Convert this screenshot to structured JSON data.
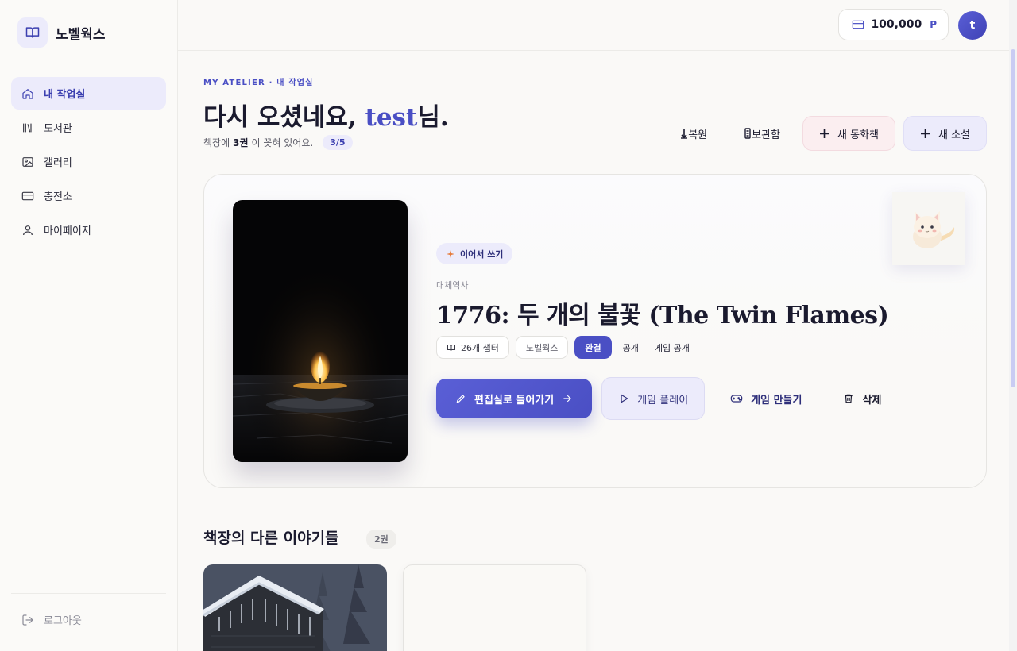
{
  "brand": {
    "name": "노벨웍스",
    "icon": "book-open-icon"
  },
  "sidebar": {
    "items": [
      {
        "label": "내 작업실",
        "icon": "home-icon",
        "active": true
      },
      {
        "label": "도서관",
        "icon": "library-icon"
      },
      {
        "label": "갤러리",
        "icon": "image-icon"
      },
      {
        "label": "충전소",
        "icon": "credit-card-icon"
      },
      {
        "label": "마이페이지",
        "icon": "user-icon"
      }
    ],
    "logout": "로그아웃"
  },
  "topbar": {
    "credits": "100,000",
    "credit_unit": "P",
    "avatar_initial": "t"
  },
  "header": {
    "eyebrow": "MY ATELIER · 내 작업실",
    "greeting_prefix": "다시 오셨네요, ",
    "user_name": "test",
    "greeting_suffix": "님.",
    "sub_prefix": "책장에 ",
    "sub_count": "3권",
    "sub_suffix": "이 꽂혀 있어요.",
    "capacity": "3/5"
  },
  "actions": {
    "restore": "복원",
    "archive": "보관함",
    "new_picture_book": "새 동화책",
    "new_novel": "새 소설"
  },
  "featured": {
    "continue_label": "이어서 쓰기",
    "genre": "대체역사",
    "title": "1776: 두 개의 불꽃 (The Twin Flames)",
    "chapters": "26개 챕터",
    "publisher": "노벨웍스",
    "status": "완결",
    "visibility": "공개",
    "game_visibility": "게임 공개",
    "enter_editor": "편집실로 들어가기",
    "game_play": "게임 플레이",
    "make_game": "게임 만들기",
    "delete": "삭제"
  },
  "shelf": {
    "title": "책장의 다른 이야기들",
    "count": "2권"
  },
  "colors": {
    "accent": "#4a4fc4",
    "accent_soft": "#ecebfb",
    "pink_soft": "#fbeef0"
  }
}
